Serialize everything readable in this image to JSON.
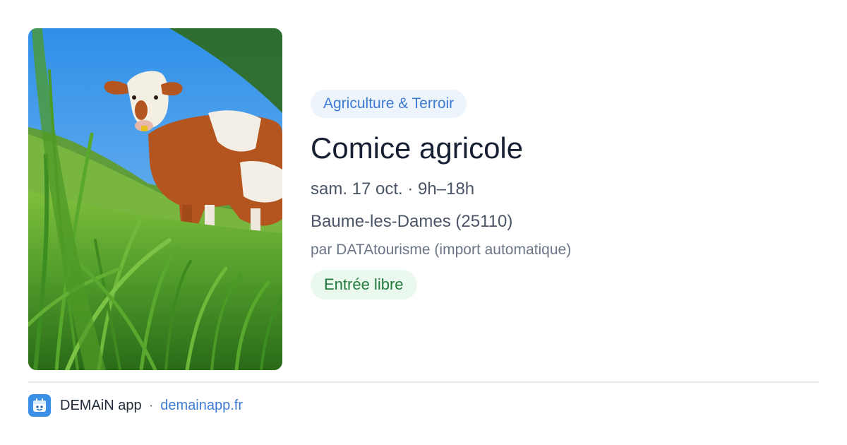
{
  "card": {
    "category": "Agriculture & Terroir",
    "title": "Comice agricole",
    "datetime": "sam. 17 oct. · 9h–18h",
    "location": "Baume-les-Dames (25110)",
    "source": "par DATAtourisme (import automatique)",
    "price": "Entrée libre",
    "image": {
      "icon": "cow-in-grass-photo"
    }
  },
  "footer": {
    "app_name": "DEMAiN app",
    "separator": "·",
    "url": "demainapp.fr",
    "icon": "demain-app-icon"
  },
  "colors": {
    "category_bg": "#eef4fc",
    "category_text": "#3d7bd2",
    "price_bg": "#eaf8ee",
    "price_text": "#227a3d",
    "title_text": "#172033",
    "link": "#3d7bd2"
  }
}
